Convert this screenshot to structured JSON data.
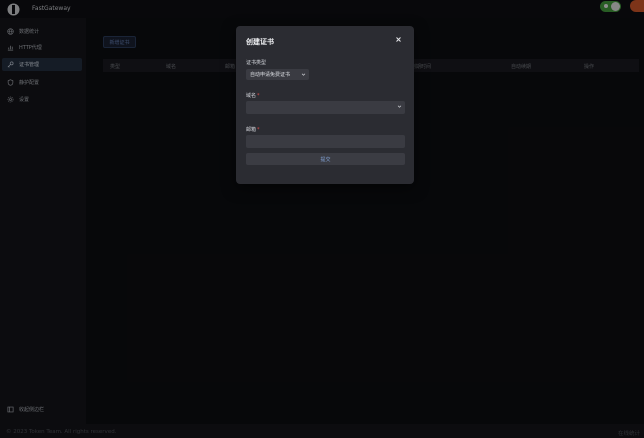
{
  "header": {
    "app_title": "FastGateway"
  },
  "sidebar": {
    "items": [
      {
        "label": "数据统计",
        "icon": "globe-icon"
      },
      {
        "label": "HTTP代理",
        "icon": "bar-chart-icon"
      },
      {
        "label": "证书管理",
        "icon": "key-icon",
        "active": true
      },
      {
        "label": "静护配置",
        "icon": "shield-icon"
      },
      {
        "label": "设置",
        "icon": "gear-icon"
      }
    ],
    "collapse_label": "收起侧边栏"
  },
  "main": {
    "add_button_label": "新增证书",
    "table_headers": [
      "类型",
      "域名",
      "邮箱",
      "",
      "",
      "到期时间",
      "自动续期",
      "操作"
    ]
  },
  "footer": {
    "copyright": "© 2023 Token Team. All rights reserved.",
    "right_text": "在线统计"
  },
  "modal": {
    "title": "创建证书",
    "cert_type_label": "证书类型",
    "cert_type_value": "自动申请免费证书",
    "domain_label": "域名",
    "email_label": "邮箱",
    "required_mark": "*",
    "submit_label": "提交"
  },
  "colors": {
    "accent": "#6b86bd",
    "active_nav": "#253143",
    "toggle": "#45a03f",
    "avatar": "#d75a2b",
    "required": "#e04a4a"
  }
}
